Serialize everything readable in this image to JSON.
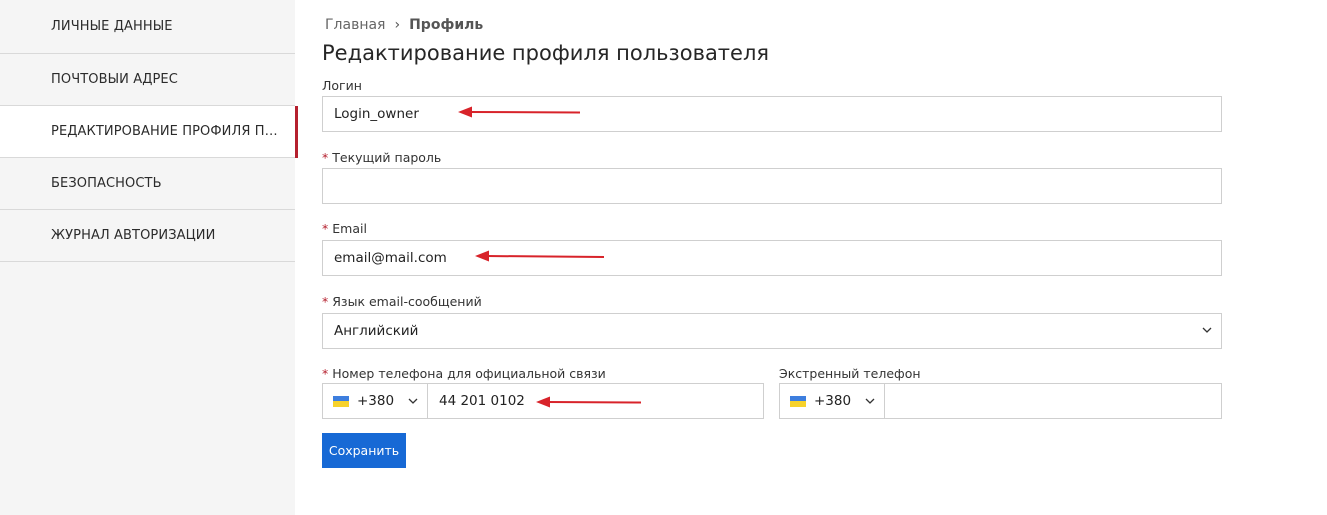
{
  "sidebar": {
    "items": [
      {
        "label": "ЛИЧНЫЕ ДАННЫЕ"
      },
      {
        "label": "ПОЧТОВЫЙ АДРЕС"
      },
      {
        "label": "РЕДАКТИРОВАНИЕ ПРОФИЛЯ ПОЛЬЗОВАТЕЛЯ",
        "active": true
      },
      {
        "label": "БЕЗОПАСНОСТЬ"
      },
      {
        "label": "ЖУРНАЛ АВТОРИЗАЦИЙ"
      }
    ]
  },
  "breadcrumb": {
    "home": "Главная",
    "separator": "›",
    "current": "Профиль"
  },
  "page_title": "Редактирование профиля пользователя",
  "form": {
    "required_mark": "*",
    "login": {
      "label": "Логин",
      "value": "Login_owner"
    },
    "current_password": {
      "label": "Текущий пароль",
      "value": ""
    },
    "email": {
      "label": "Email",
      "value": "email@mail.com"
    },
    "email_language": {
      "label": "Язык email-сообщений",
      "selected": "Английский"
    },
    "phone": {
      "label": "Номер телефона для официальной связи",
      "country_code": "+380",
      "number": "44 201 0102"
    },
    "emergency_phone": {
      "label": "Экстренный телефон",
      "country_code": "+380",
      "number": ""
    },
    "save_label": "Сохранить"
  },
  "colors": {
    "accent": "#b5202e",
    "primary_button": "#1769d5",
    "annotation_arrow": "#d8232a"
  },
  "icons": {
    "flag": "ukraine-flag-icon",
    "dropdown": "chevron-down-icon"
  }
}
